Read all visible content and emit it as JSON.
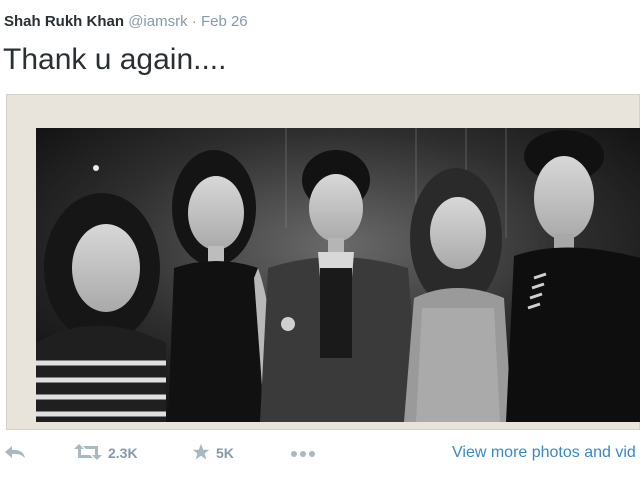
{
  "tweet": {
    "name": "Shah Rukh Khan",
    "handle": "@iamsrk",
    "separator": "·",
    "date": "Feb 26",
    "text": "Thank u again...."
  },
  "actions": {
    "reply_icon": "reply-arrow-icon",
    "retweet_icon": "retweet-icon",
    "retweet_count": "2.3K",
    "favorite_icon": "star-icon",
    "favorite_count": "5K",
    "more_icon": "more-dots-icon",
    "view_more": "View more photos and vid"
  },
  "colors": {
    "text": "#292f33",
    "muted": "#8899a6",
    "link": "#3b88c3",
    "frame": "#e8e4dc"
  }
}
